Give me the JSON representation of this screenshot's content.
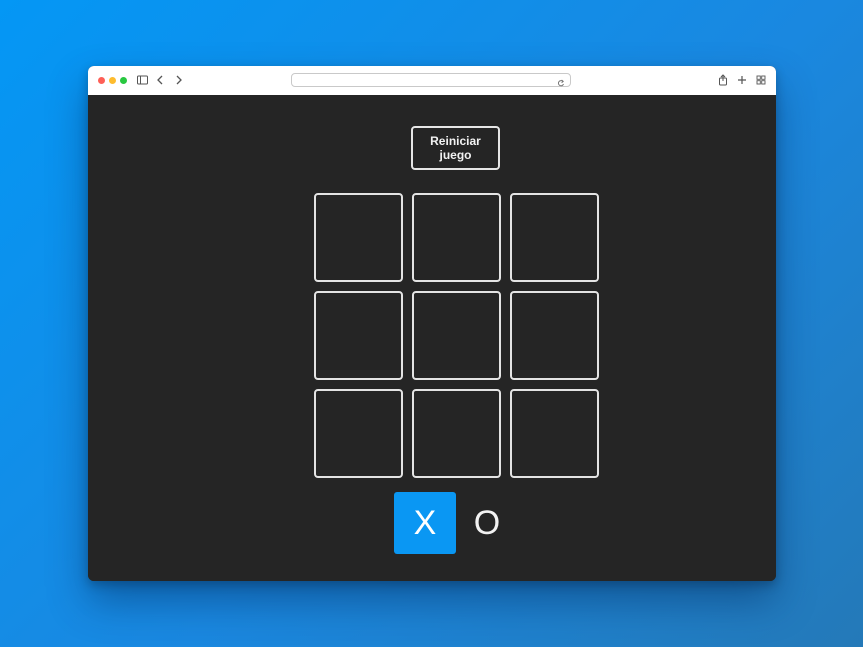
{
  "browser": {
    "address": ""
  },
  "game": {
    "restart_label": "Reiniciar juego",
    "cells": [
      "",
      "",
      "",
      "",
      "",
      "",
      "",
      "",
      ""
    ],
    "turn_indicator": {
      "x_label": "X",
      "o_label": "O",
      "active": "X",
      "active_color": "#0a97f3"
    }
  },
  "colors": {
    "background": "#252525",
    "cell_border": "#e4e4e4",
    "desktop": "#0497f5"
  },
  "icons": [
    "sidebar-icon",
    "back-icon",
    "forward-icon",
    "reload-icon",
    "share-icon",
    "new-tab-icon",
    "tab-overview-icon"
  ]
}
